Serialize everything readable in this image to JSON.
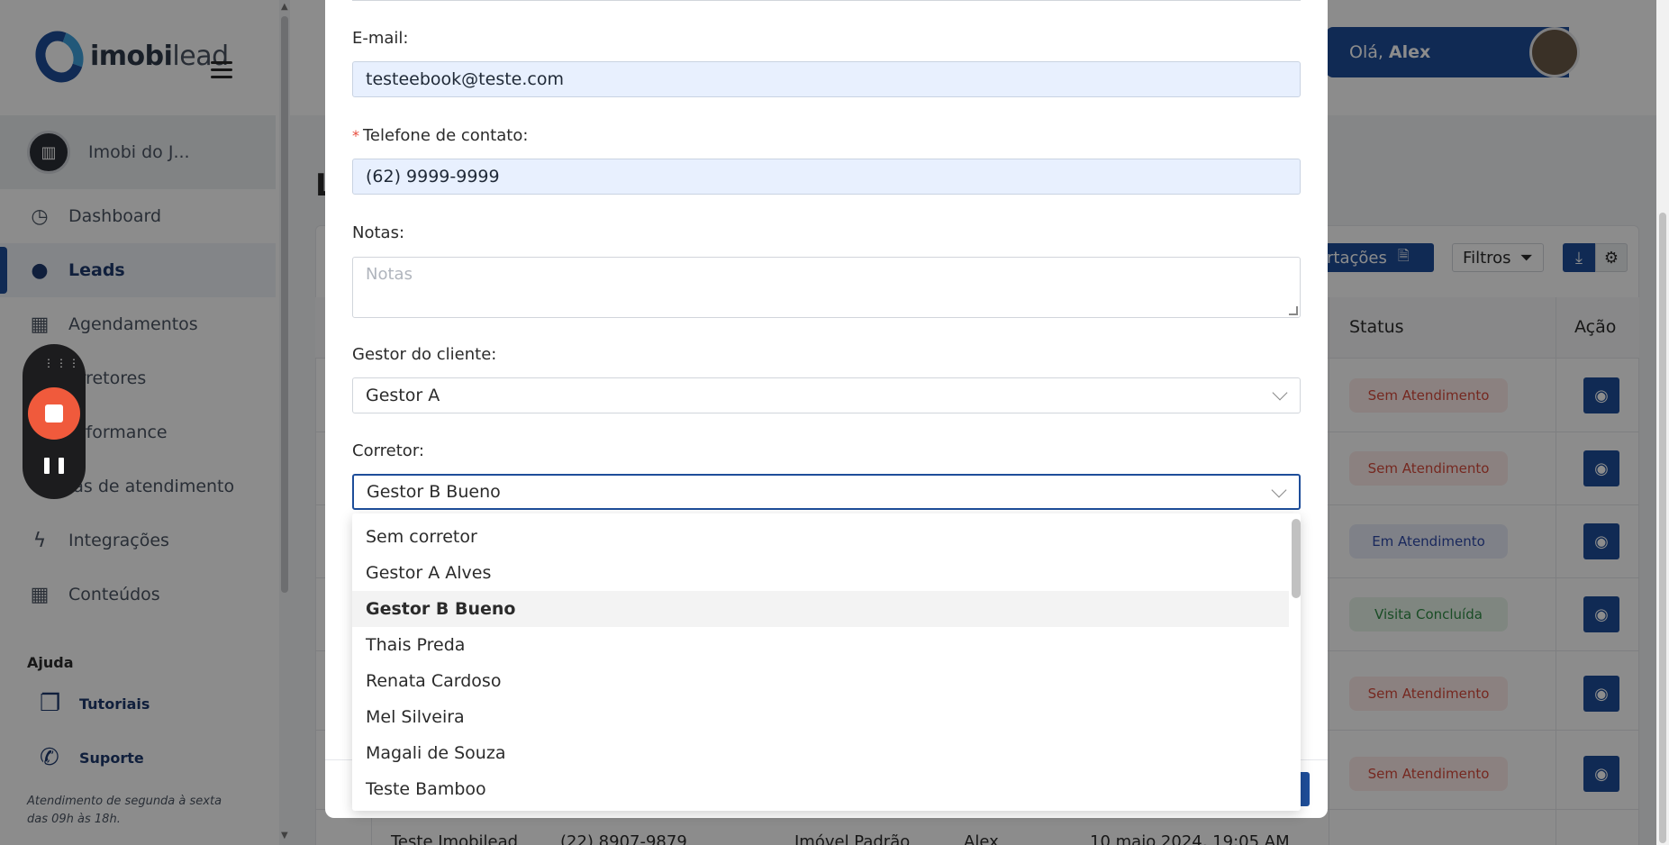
{
  "app": {
    "logo_bold": "imobi",
    "logo_light": "lead",
    "company_name": "Imobi do J...",
    "greeting_prefix": "Olá,",
    "greeting_name": "Alex",
    "page_letter": "L"
  },
  "sidebar": {
    "items": [
      {
        "label": "Dashboard",
        "icon": "gauge-icon",
        "glyph": "◷"
      },
      {
        "label": "Leads",
        "icon": "user-icon",
        "glyph": "👤"
      },
      {
        "label": "Agendamentos",
        "icon": "calendar-icon",
        "glyph": "▦"
      },
      {
        "label": "orretores",
        "icon": "users-icon",
        "glyph": ""
      },
      {
        "label": "erformance",
        "icon": "chart-icon",
        "glyph": ""
      },
      {
        "label": "las de atendimento",
        "icon": "queue-icon",
        "glyph": ""
      },
      {
        "label": "Integrações",
        "icon": "bolt-icon",
        "glyph": "ϟ"
      },
      {
        "label": "Conteúdos",
        "icon": "grid-icon",
        "glyph": "▦"
      }
    ],
    "help_title": "Ajuda",
    "help_links": [
      {
        "label": "Tutoriais",
        "icon": "book-icon",
        "glyph": "❐"
      },
      {
        "label": "Suporte",
        "icon": "whatsapp-icon",
        "glyph": "✆"
      }
    ],
    "help_note": "Atendimento de segunda à sexta das 09h às 18h."
  },
  "toolbar": {
    "import_label": "ortações",
    "filters_label": "Filtros"
  },
  "table": {
    "headers": {
      "status": "Status",
      "action": "Ação"
    },
    "statuses": [
      "Sem Atendimento",
      "Sem Atendimento",
      "Em Atendimento",
      "Visita Concluída",
      "Sem Atendimento",
      "Sem Atendimento"
    ],
    "status_kinds": [
      "red",
      "red",
      "blue",
      "green",
      "red",
      "red"
    ],
    "partial_row": [
      "Teste Imobilead",
      "(22) 8907-9879",
      "Imóvel Padrão",
      "Alex",
      "10 maio 2024, 19:05 AM"
    ]
  },
  "modal": {
    "email_label": "E-mail:",
    "email_value": "testeebook@teste.com",
    "phone_label": "Telefone de contato:",
    "phone_required": "*",
    "phone_value": "(62) 9999-9999",
    "notes_label": "Notas:",
    "notes_placeholder": "Notas",
    "manager_label": "Gestor do cliente:",
    "manager_value": "Gestor A",
    "broker_label": "Corretor:",
    "broker_value": "Gestor B Bueno",
    "broker_options": [
      "Sem corretor",
      "Gestor A Alves",
      "Gestor B Bueno",
      "Thais Preda",
      "Renata Cardoso",
      "Mel Silveira",
      "Magali de Souza",
      "Teste Bamboo"
    ],
    "broker_selected_index": 2
  },
  "colors": {
    "brand": "#1e4e9a",
    "status_red": "#d64a3b",
    "status_blue": "#2f4aa8",
    "status_green": "#2f8a44",
    "record": "#f05a3c"
  }
}
